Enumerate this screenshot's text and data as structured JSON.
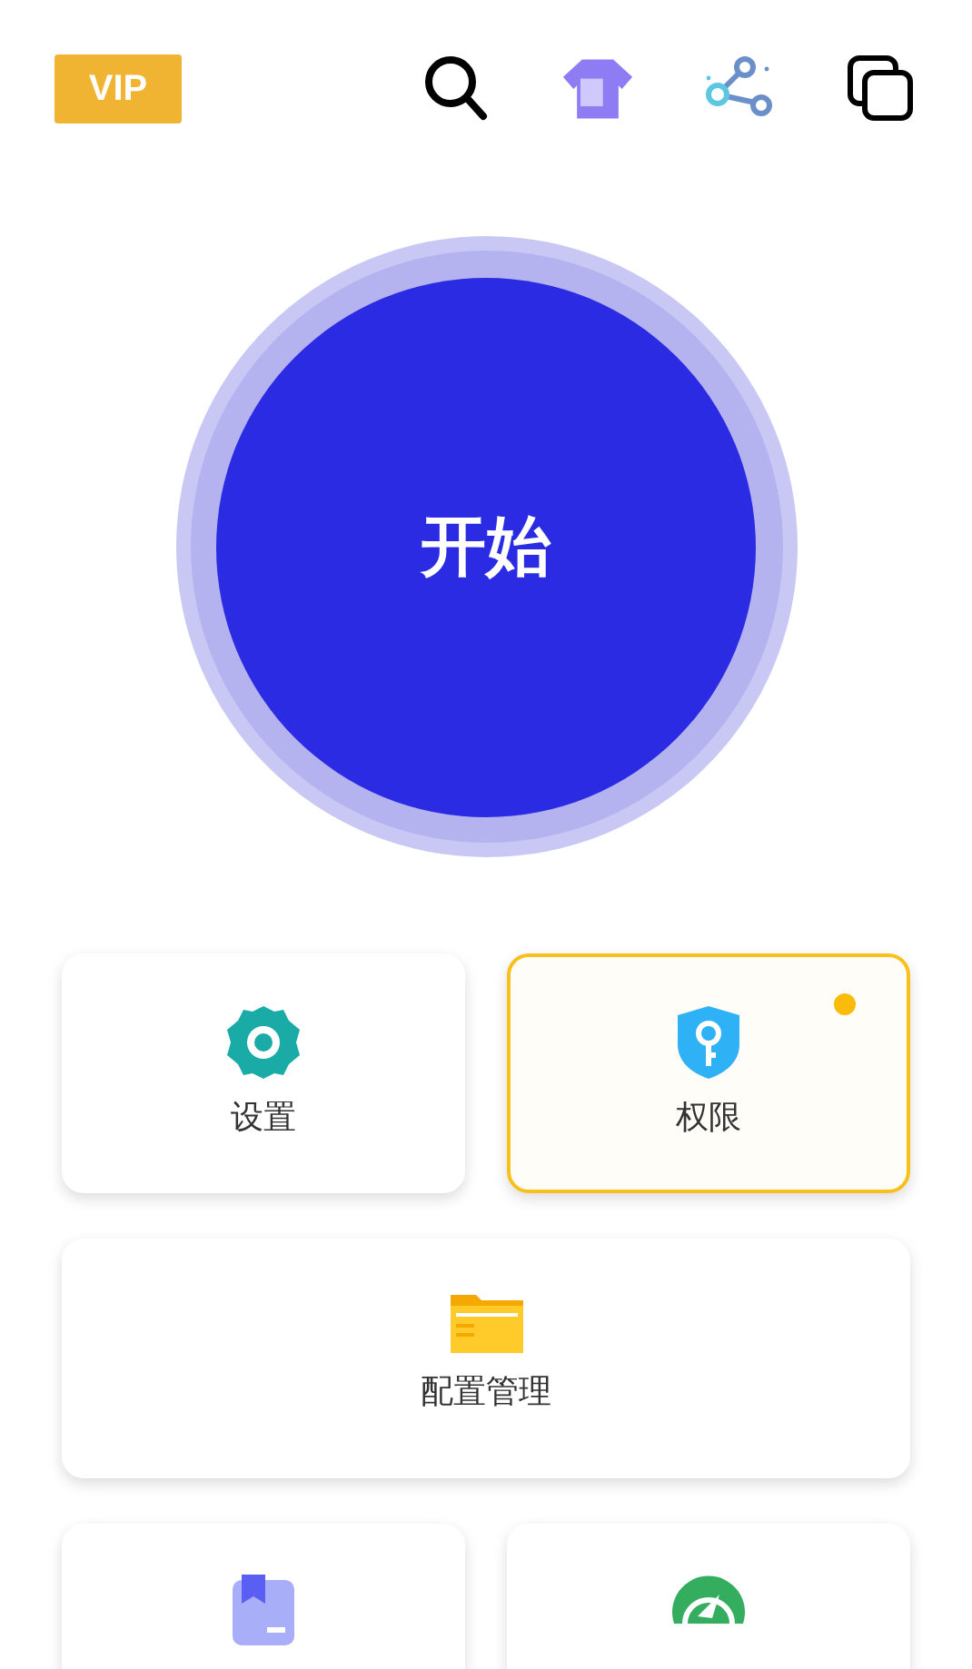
{
  "header": {
    "vip": "VIP",
    "actions": [
      {
        "kind": "search"
      },
      {
        "kind": "shirt"
      },
      {
        "kind": "share"
      },
      {
        "kind": "copy"
      }
    ]
  },
  "start_button": {
    "label": "开始"
  },
  "tiles": [
    {
      "kind": "half",
      "label": "设置",
      "selected": false,
      "notification": false
    },
    {
      "kind": "half",
      "label": "权限",
      "selected": true,
      "notification": true
    },
    {
      "kind": "wide",
      "label": "配置管理",
      "selected": false,
      "notification": false
    },
    {
      "kind": "half",
      "selected": false,
      "notification": false
    },
    {
      "kind": "half",
      "selected": false,
      "notification": false
    }
  ]
}
